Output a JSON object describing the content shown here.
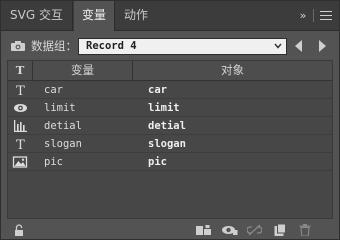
{
  "tabs": [
    {
      "label": "SVG 交互"
    },
    {
      "label": "变量"
    },
    {
      "label": "动作"
    }
  ],
  "tab_overflow": "»",
  "dataset": {
    "label": "数据组：",
    "value": "Record 4"
  },
  "table": {
    "headers": {
      "type": "T",
      "variable": "变量",
      "object": "对象"
    },
    "rows": [
      {
        "icon": "text-type-icon",
        "variable": "car",
        "object": "car"
      },
      {
        "icon": "visibility-eye-icon",
        "variable": "limit",
        "object": "limit"
      },
      {
        "icon": "graph-data-icon",
        "variable": "detial",
        "object": "detial"
      },
      {
        "icon": "text-type-icon",
        "variable": "slogan",
        "object": "slogan"
      },
      {
        "icon": "image-type-icon",
        "variable": "pic",
        "object": "pic"
      }
    ]
  },
  "colors": {
    "panel_bg": "#535353",
    "tab_bar_bg": "#3c3c3c",
    "table_bg": "#474747",
    "text": "#dcdcdc"
  }
}
